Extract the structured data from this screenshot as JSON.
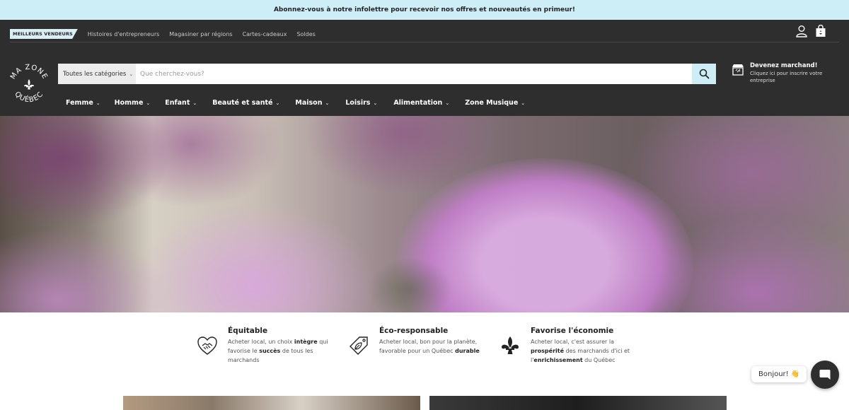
{
  "announcement": "Abonnez-vous à notre infolettre pour recevoir nos offres et nouveautés en primeur!",
  "topnav": {
    "badge": "MEILLEURS VENDEURS",
    "links": [
      "Histoires d'entrepreneurs",
      "Magasiner par régions",
      "Cartes-cadeaux",
      "Soldes"
    ]
  },
  "logo": {
    "line1": "MA ZONE",
    "line2": "QUÉBEC"
  },
  "search": {
    "category": "Toutes les catégories",
    "placeholder": "Que cherchez-vous?"
  },
  "merchant": {
    "title": "Devenez marchand!",
    "subtitle": "Cliquez ici pour inscrire votre entreprise"
  },
  "mainnav": [
    "Femme",
    "Homme",
    "Enfant",
    "Beauté et santé",
    "Maison",
    "Loisirs",
    "Alimentation",
    "Zone Musique"
  ],
  "features": [
    {
      "title": "Équitable",
      "icon": "handshake-heart-icon",
      "d1": "Acheter local, un choix ",
      "b1": "intègre",
      "d2": " qui favorise le ",
      "b2": "succès",
      "d3": " de tous les marchands"
    },
    {
      "title": "Éco-responsable",
      "icon": "leaf-tag-icon",
      "d1": "Acheter local, bon pour la planète, favorable pour un Québec ",
      "b1": "durable",
      "d2": "",
      "b2": "",
      "d3": ""
    },
    {
      "title": "Favorise l'économie",
      "icon": "fleur-de-lis-icon",
      "d1": "Acheter local, c'est assurer la ",
      "b1": "prospérité",
      "d2": " des marchands d'ici et l'",
      "b2": "enrichissement",
      "d3": " du Québec"
    }
  ],
  "chat": {
    "greeting": "Bonjour!",
    "emoji": "👋"
  },
  "colors": {
    "header": "#2e2e2e",
    "accent": "#cdeef6"
  }
}
